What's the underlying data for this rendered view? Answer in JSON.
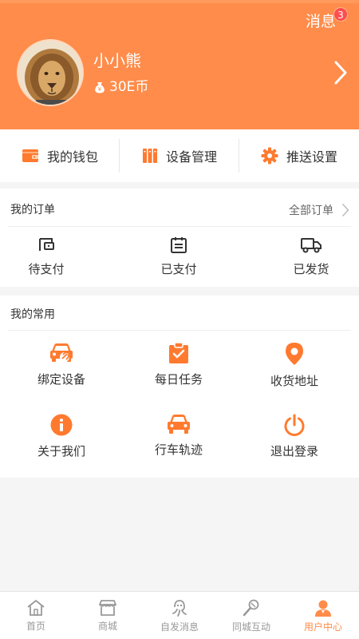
{
  "header": {
    "messages_label": "消息",
    "messages_badge": "3",
    "username": "小小熊",
    "coins": "30E币",
    "accent_color": "#ff8c4a"
  },
  "quick_bar": {
    "wallet": "我的钱包",
    "devices": "设备管理",
    "push": "推送设置"
  },
  "orders": {
    "title": "我的订单",
    "all_orders": "全部订单",
    "pending_payment": "待支付",
    "paid": "已支付",
    "shipped": "已发货"
  },
  "common": {
    "title": "我的常用",
    "bind_device": "绑定设备",
    "daily_tasks": "每日任务",
    "shipping_address": "收货地址",
    "about_us": "关于我们",
    "driving_track": "行车轨迹",
    "logout": "退出登录"
  },
  "tabbar": {
    "home": "首页",
    "mall": "商城",
    "messages": "自发消息",
    "interaction": "同城互动",
    "user_center": "用户中心"
  }
}
